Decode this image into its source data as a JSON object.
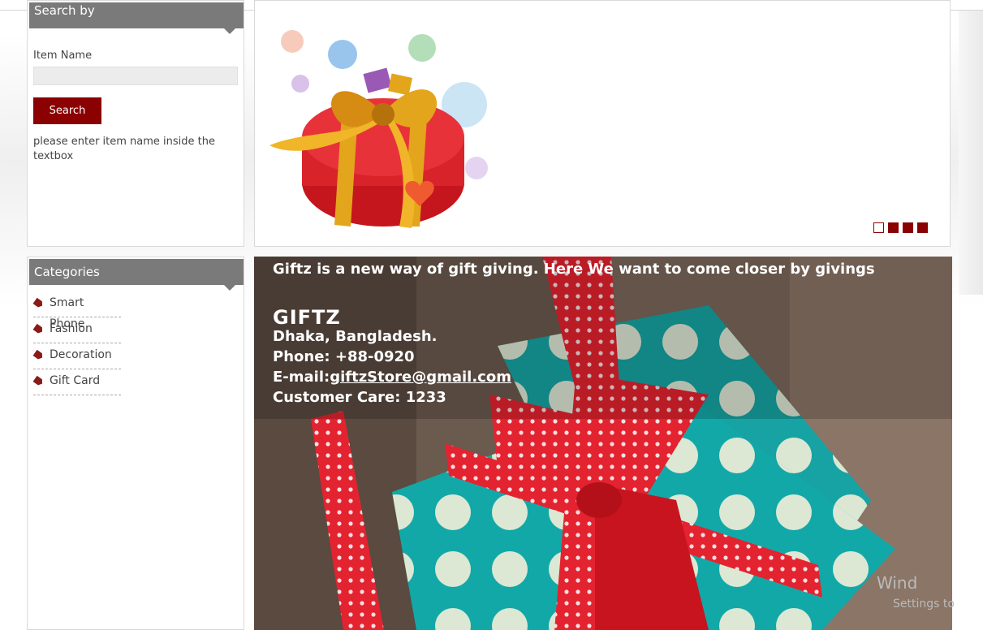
{
  "search": {
    "title": "Search by",
    "item_label": "Item Name",
    "item_value": "",
    "button_label": "Search",
    "hint": "please enter item name inside the textbox"
  },
  "slider": {
    "slides": 4,
    "active_slide": 1
  },
  "categories": {
    "title": "Categories",
    "items": [
      {
        "label": "Smart Phone"
      },
      {
        "label": "Fashion"
      },
      {
        "label": "Decoration"
      },
      {
        "label": "Gift Card"
      }
    ]
  },
  "hero": {
    "tagline": "Giftz is a new way of gift giving. Here We want to come closer by givings",
    "brand": "GIFTZ",
    "address": "Dhaka, Bangladesh.",
    "phone": "Phone: +88-0920",
    "email_label": "E-mail:",
    "email": "giftzStore@gmail.com",
    "care": "Customer Care: 1233"
  },
  "watermark": {
    "line1": "Wind",
    "line2": "Settings to"
  },
  "colors": {
    "accent": "#8b0000",
    "header_bar": "#7a7a7a"
  }
}
